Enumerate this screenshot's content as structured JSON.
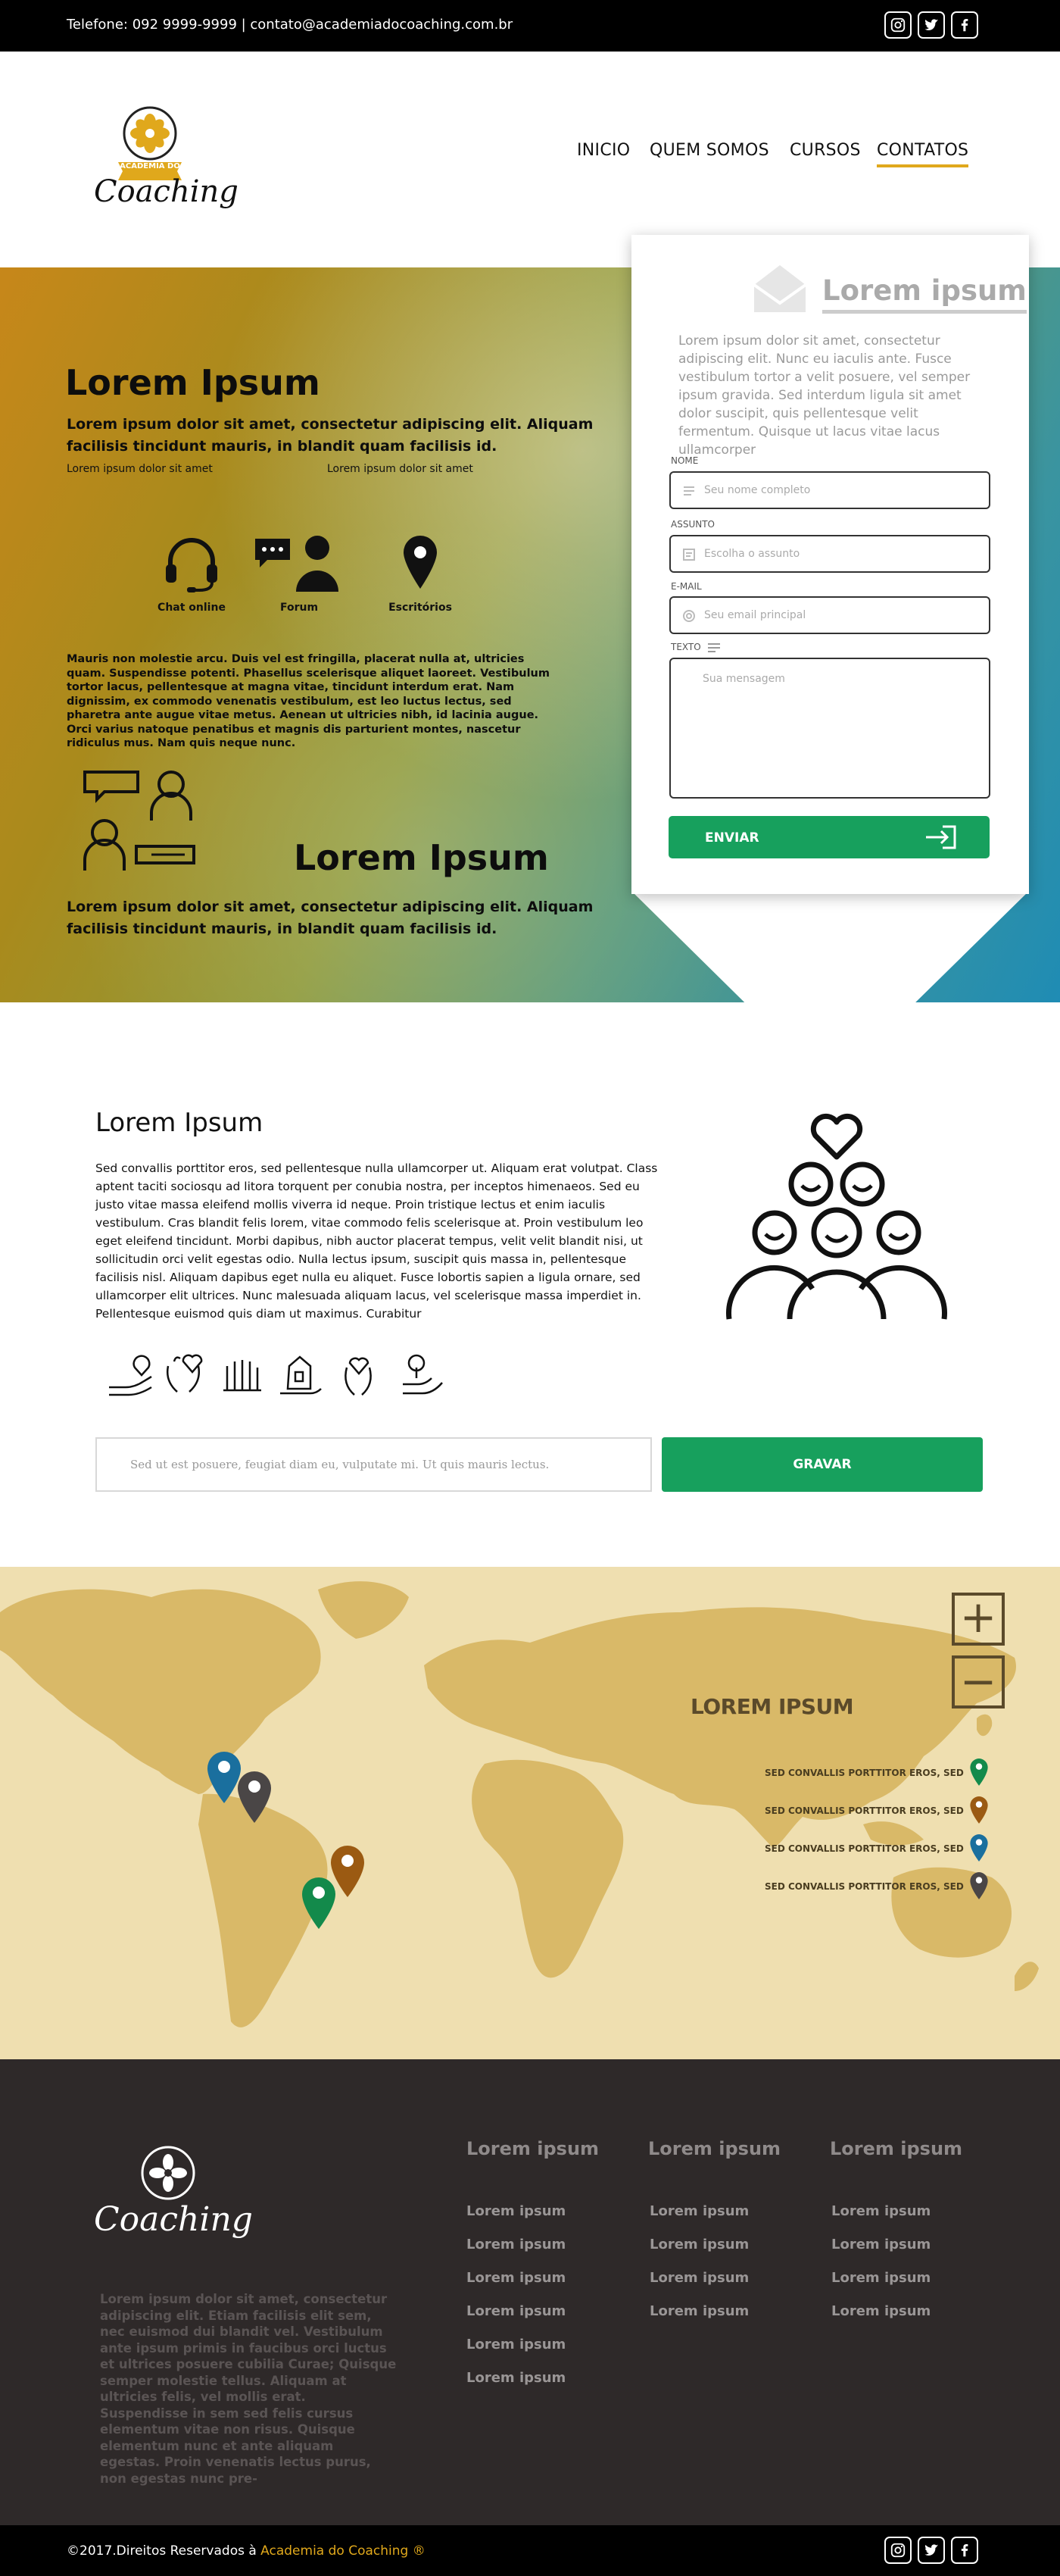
{
  "topbar": {
    "contact": "Telefone: 092 9999-9999   |  contato@academiadocoaching.com.br",
    "social_icons": [
      "instagram-icon",
      "twitter-icon",
      "facebook-icon"
    ]
  },
  "logo": {
    "badge_text": "ACADEMIA DO",
    "word": "Coaching"
  },
  "nav": {
    "items": [
      "INICIO",
      "QUEM SOMOS",
      "CURSOS",
      "CONTATOS"
    ],
    "active": "CONTATOS",
    "accent": "#e0a81c"
  },
  "hero": {
    "title": "Lorem Ipsum",
    "subtitle": "Lorem ipsum dolor sit amet, consectetur adipiscing elit. Aliquam facilisis tincidunt mauris, in blandit quam facilisis id.",
    "small_left": "Lorem ipsum dolor sit amet",
    "small_right": "Lorem ipsum dolor sit amet",
    "features": [
      {
        "label": "Chat online",
        "icon": "headset-icon"
      },
      {
        "label": "Forum",
        "icon": "forum-icon"
      },
      {
        "label": "Escritórios",
        "icon": "location-pin-icon"
      }
    ],
    "paragraph": "Mauris non molestie arcu. Duis vel est fringilla, placerat nulla at, ultricies quam. Suspendisse potenti. Phasellus scelerisque aliquet laoreet. Vestibulum tortor lacus, pellentesque at magna vitae, tincidunt interdum erat. Nam dignissim, ex commodo venenatis vestibulum, est leo luctus lectus, sed pharetra ante augue vitae metus. Aenean ut ultricies nibh, id lacinia augue. Orci varius natoque penatibus et magnis dis parturient montes, nascetur ridiculus mus. Nam quis neque nunc.",
    "title2": "Lorem Ipsum",
    "subtitle2": "Lorem ipsum dolor sit amet, consectetur adipiscing elit. Aliquam facilisis tincidunt mauris, in blandit quam facilisis id."
  },
  "form": {
    "title": "Lorem ipsum",
    "intro": "Lorem ipsum dolor sit amet, consectetur adipiscing elit. Nunc eu iaculis ante. Fusce vestibulum tortor a velit posuere, vel semper ipsum gravida. Sed interdum ligula sit amet dolor suscipit, quis pellentesque velit fermentum. Quisque ut lacus vitae lacus ullamcorper",
    "fields": [
      {
        "label": "NOME",
        "placeholder": "Seu nome completo"
      },
      {
        "label": "ASSUNTO",
        "placeholder": "Escolha o assunto"
      },
      {
        "label": "E-MAIL",
        "placeholder": "Seu email principal"
      },
      {
        "label": "TEXTO",
        "placeholder": "Sua mensagem"
      }
    ],
    "submit": "ENVIAR",
    "accent": "#17a05d"
  },
  "about": {
    "title": "Lorem Ipsum",
    "text": "Sed convallis porttitor eros, sed pellentesque nulla ullamcorper ut. Aliquam erat volutpat. Class aptent taciti sociosqu ad litora torquent per conubia nostra, per inceptos himenaeos. Sed eu justo vitae massa eleifend mollis viverra id neque. Proin tristique lectus et enim iaculis vestibulum. Cras blandit felis lorem, vitae commodo felis scelerisque at. Proin vestibulum leo eget eleifend tincidunt. Morbi dapibus, nibh auctor placerat tempus, velit velit blandit nisi, ut sollicitudin orci velit egestas odio. Nulla lectus ipsum, suscipit quis massa in, pellentesque facilisis nisl. Aliquam dapibus eget nulla eu aliquet. Fusce lobortis sapien a ligula ornare, sed ullamcorper elit ultrices. Nunc malesuada aliquam lacus, vel scelerisque massa imperdiet in. Pellentesque euismod quis diam ut maximus. Curabitur",
    "input_placeholder": "Sed ut est posuere, feugiat diam eu, vulputate mi. Ut quis mauris lectus.",
    "button": "GRAVAR"
  },
  "map": {
    "title": "LOREM IPSUM",
    "legend": [
      {
        "label": "SED CONVALLIS PORTTITOR EROS, SED",
        "color": "#138a4b"
      },
      {
        "label": "SED CONVALLIS PORTTITOR EROS, SED",
        "color": "#9b5a12"
      },
      {
        "label": "SED CONVALLIS PORTTITOR EROS, SED",
        "color": "#1a6f9e"
      },
      {
        "label": "SED CONVALLIS PORTTITOR EROS, SED",
        "color": "#4a4646"
      }
    ],
    "zoom_in": "+",
    "zoom_out": "−"
  },
  "footer": {
    "logo_word": "Coaching",
    "about": "Lorem ipsum dolor sit amet, consectetur adipiscing elit. Etiam facilisis elit sem, nec euismod dui blandit vel. Vestibulum ante ipsum primis in faucibus orci luctus et ultrices posuere cubilia Curae; Quisque semper molestie tellus. Aliquam at ultricies felis, vel mollis erat. Suspendisse in sem sed felis cursus elementum vitae non risus. Quisque elementum nunc et ante aliquam egestas. Proin venenatis lectus purus, non egestas nunc pre-",
    "columns": [
      {
        "title": "Lorem ipsum",
        "links": [
          "Lorem ipsum",
          "Lorem ipsum",
          "Lorem ipsum",
          "Lorem ipsum",
          "Lorem ipsum",
          "Lorem ipsum"
        ]
      },
      {
        "title": "Lorem ipsum",
        "links": [
          "Lorem ipsum",
          "Lorem ipsum",
          "Lorem ipsum",
          "Lorem ipsum"
        ]
      },
      {
        "title": "Lorem ipsum",
        "links": [
          "Lorem ipsum",
          "Lorem ipsum",
          "Lorem ipsum",
          "Lorem ipsum"
        ]
      }
    ],
    "copyright_prefix": "©2017.Direitos Reservados à ",
    "copyright_brand": "Academia do Coaching ®",
    "brand_color": "#e0a81c"
  }
}
